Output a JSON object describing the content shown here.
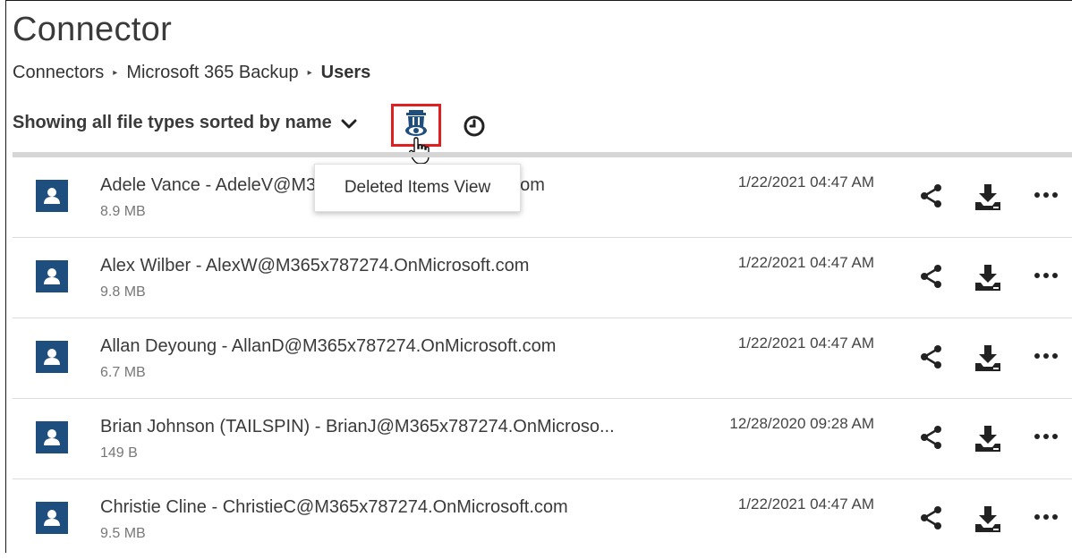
{
  "page": {
    "title": "Connector"
  },
  "breadcrumb": {
    "items": [
      "Connectors",
      "Microsoft 365 Backup",
      "Users"
    ]
  },
  "toolbar": {
    "sort_label": "Showing all file types sorted by name"
  },
  "tooltip": {
    "text": "Deleted Items View"
  },
  "icons": {
    "sort": "chevron-down-icon",
    "deleted_view": "trash-eye-icon",
    "history": "clock-icon",
    "row_actions": [
      "share-icon",
      "download-icon",
      "more-icon"
    ]
  },
  "colors": {
    "accent_blue": "#1e4e7e",
    "highlight_red": "#e02020",
    "divider": "#d6d6d6"
  },
  "rows": [
    {
      "name": "Adele Vance - AdeleV@M365x787274.OnMicrosoft.com",
      "size": "8.9 MB",
      "date": "1/22/2021 04:47 AM"
    },
    {
      "name": "Alex Wilber - AlexW@M365x787274.OnMicrosoft.com",
      "size": "9.8 MB",
      "date": "1/22/2021 04:47 AM"
    },
    {
      "name": "Allan Deyoung - AllanD@M365x787274.OnMicrosoft.com",
      "size": "6.7 MB",
      "date": "1/22/2021 04:47 AM"
    },
    {
      "name": "Brian Johnson (TAILSPIN) - BrianJ@M365x787274.OnMicroso...",
      "size": "149 B",
      "date": "12/28/2020 09:28 AM"
    },
    {
      "name": "Christie Cline - ChristieC@M365x787274.OnMicrosoft.com",
      "size": "9.5 MB",
      "date": "1/22/2021 04:47 AM"
    }
  ]
}
